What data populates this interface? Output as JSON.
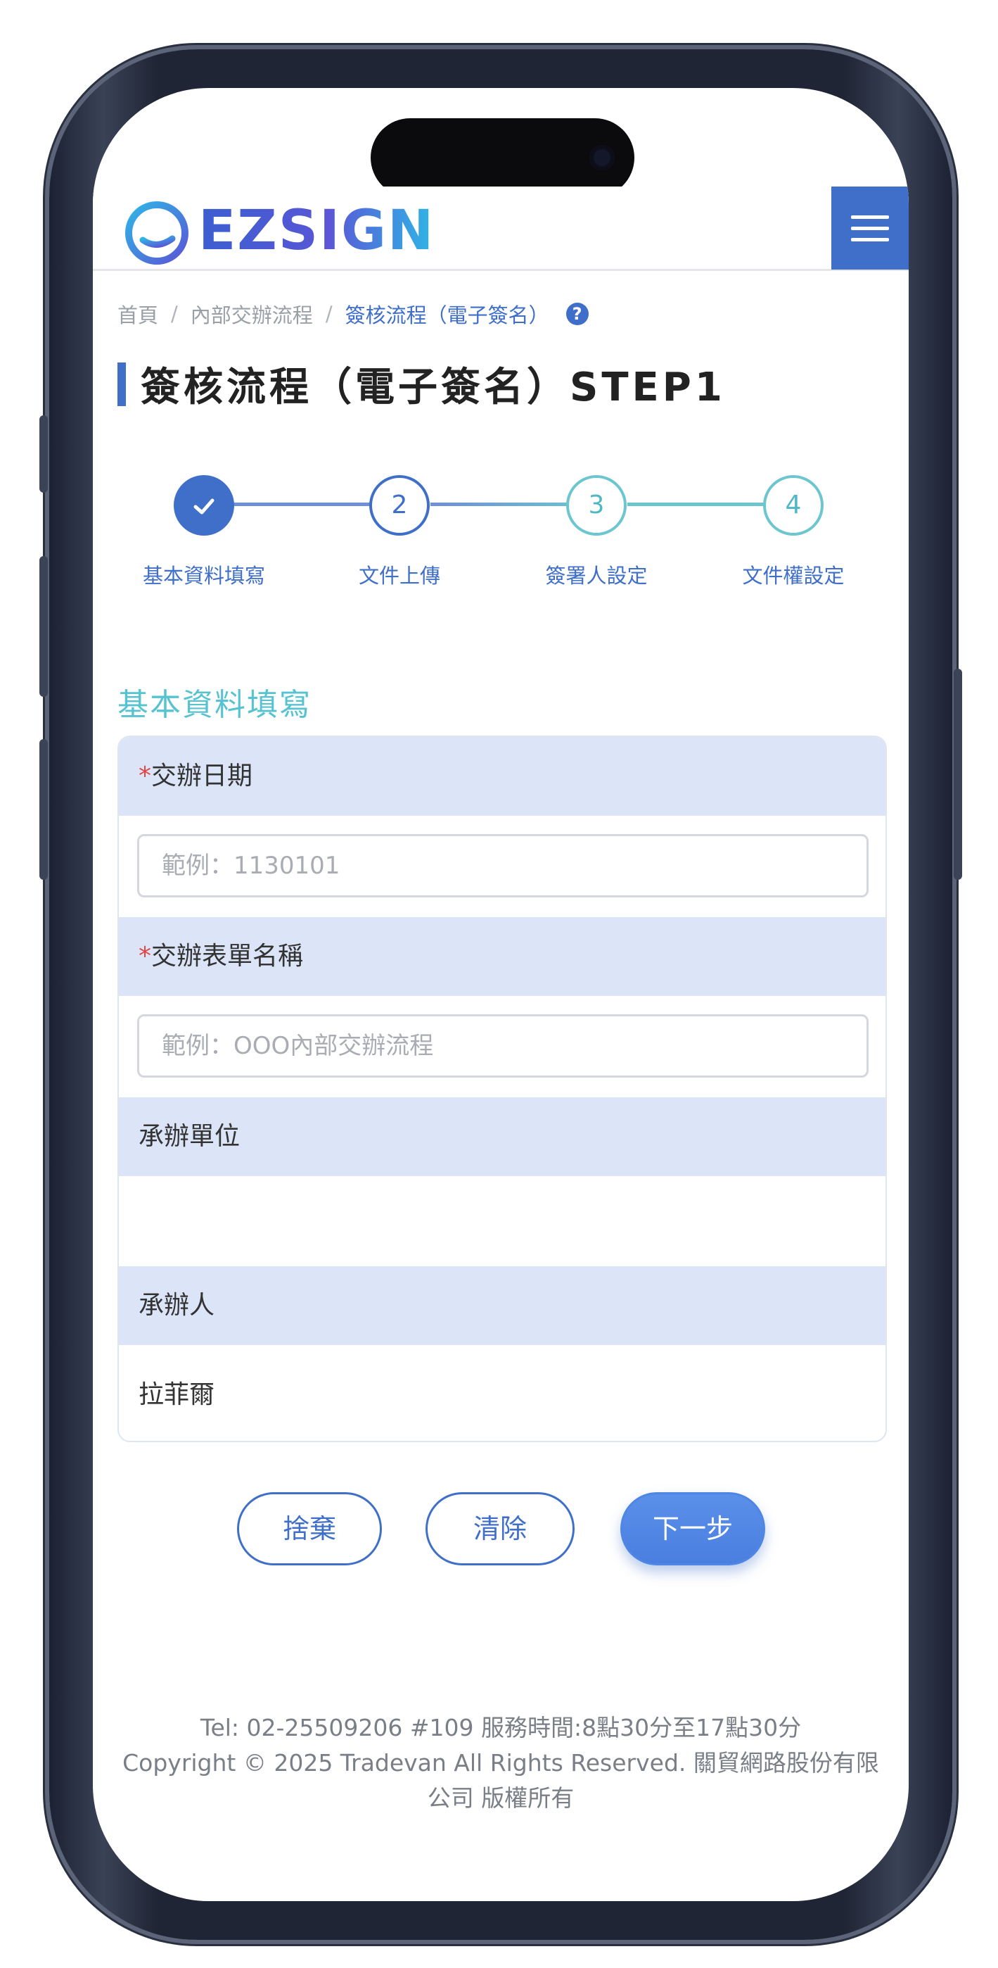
{
  "header": {
    "logo_text": "EZSIGN",
    "menu_icon": "hamburger-menu-icon"
  },
  "breadcrumb": {
    "items": [
      "首頁",
      "內部交辦流程",
      "簽核流程（電子簽名）"
    ],
    "separator": "/",
    "help_icon": "question-circle-icon"
  },
  "page_title": "簽核流程（電子簽名）STEP1",
  "stepper": {
    "steps": [
      {
        "number": "",
        "label": "基本資料填寫",
        "state": "done"
      },
      {
        "number": "2",
        "label": "文件上傳",
        "state": "pending"
      },
      {
        "number": "3",
        "label": "簽署人設定",
        "state": "pending"
      },
      {
        "number": "4",
        "label": "文件權設定",
        "state": "pending"
      }
    ],
    "done_icon": "check-icon"
  },
  "section_title": "基本資料填寫",
  "form": {
    "date": {
      "required_mark": "*",
      "label": "交辦日期",
      "value": "",
      "placeholder": "範例：1130101"
    },
    "form_name": {
      "required_mark": "*",
      "label": "交辦表單名稱",
      "value": "",
      "placeholder": "範例：OOO內部交辦流程"
    },
    "unit": {
      "label": "承辦單位",
      "value": ""
    },
    "handler": {
      "label": "承辦人",
      "value": "拉菲爾"
    }
  },
  "actions": {
    "discard": "捨棄",
    "clear": "清除",
    "next": "下一步"
  },
  "footer": {
    "line1": "Tel: 02-25509206 #109 服務時間:8點30分至17點30分",
    "line2": "Copyright © 2025 Tradevan All Rights Reserved. 關貿網路股份有限公司 版權所有"
  },
  "colors": {
    "primary": "#3f6fc9",
    "accent_teal": "#58c3d0",
    "label_bg": "#dbe5f7",
    "required": "#e04646"
  }
}
